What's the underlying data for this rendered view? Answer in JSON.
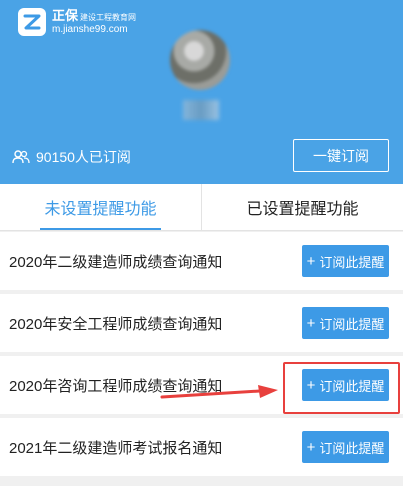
{
  "header": {
    "logo": {
      "name": "正保",
      "name_small": "建设工程教育网",
      "url": "m.jianshe99.com"
    },
    "subscribers_text": "90150人已订阅",
    "one_key_subscribe": "一键订阅"
  },
  "tabs": [
    {
      "label": "未设置提醒功能",
      "active": true
    },
    {
      "label": "已设置提醒功能",
      "active": false
    }
  ],
  "items": [
    {
      "title": "2020年二级建造师成绩查询通知",
      "button": "订阅此提醒"
    },
    {
      "title": "2020年安全工程师成绩查询通知",
      "button": "订阅此提醒"
    },
    {
      "title": "2020年咨询工程师成绩查询通知",
      "button": "订阅此提醒"
    },
    {
      "title": "2021年二级建造师考试报名通知",
      "button": "订阅此提醒"
    }
  ],
  "colors": {
    "header_bg": "#4aa3e6",
    "accent": "#3d9ae6",
    "annotation": "#e8403d"
  }
}
